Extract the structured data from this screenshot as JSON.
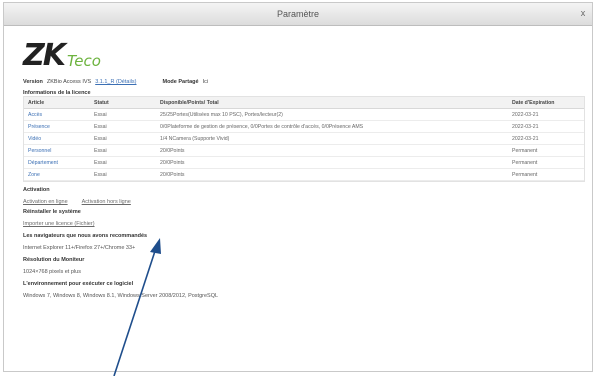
{
  "window": {
    "title": "Paramètre",
    "close_glyph": "x"
  },
  "logo": {
    "main": "ZK",
    "sub": "Teco"
  },
  "version": {
    "label": "Version",
    "value": "ZKBio Access IVS",
    "link": "3.1.1_R (Détails)",
    "mode_label": "Mode Partagé",
    "mode_value": "Ici"
  },
  "license": {
    "heading": "Informations de la licence",
    "columns": [
      "Article",
      "Statut",
      "Disponible/Points/ Total",
      "Date d'Expiration"
    ],
    "rows": [
      {
        "article": "Accès",
        "status": "Essai",
        "detail": "25/25Portes(Utilisées max 10 PSC), Portes/lecteur(2)",
        "expiry": "2022-03-21"
      },
      {
        "article": "Présence",
        "status": "Essai",
        "detail": "0/0Plateforme de gestion de présence, 0/0Portes de contrôle d'accès, 0/0Présence AMS",
        "expiry": "2022-03-21"
      },
      {
        "article": "Vidéo",
        "status": "Essai",
        "detail": "1/4 NCamera (Supporte Vivid)",
        "expiry": "2022-03-21"
      },
      {
        "article": "Personnel",
        "status": "Essai",
        "detail": "20/0Points",
        "expiry": "Permanent"
      },
      {
        "article": "Département",
        "status": "Essai",
        "detail": "20/0Points",
        "expiry": "Permanent"
      },
      {
        "article": "Zone",
        "status": "Essai",
        "detail": "20/0Points",
        "expiry": "Permanent"
      }
    ]
  },
  "activation": {
    "heading": "Activation",
    "online_link": "Activation en ligne",
    "offline_link": "Activation hors ligne"
  },
  "reinstall": {
    "heading": "Réinstaller le système",
    "link": "Importer une licence (Fichier)"
  },
  "browsers": {
    "heading": "Les navigateurs que nous avons recommandés",
    "text": "Internet Explorer 11+/Firefox 27+/Chrome 33+"
  },
  "resolution": {
    "heading": "Résolution du Moniteur",
    "text": "1024×768 pixels et plus"
  },
  "environment": {
    "heading": "L'environnement pour exécuter ce logiciel",
    "text": "Windows 7, Windows 8, Windows 8.1, Windows Server 2008/2012, PostgreSQL"
  },
  "colors": {
    "link": "#3b6fb4",
    "logo_green": "#6db33f",
    "arrow": "#1f4e8c"
  }
}
